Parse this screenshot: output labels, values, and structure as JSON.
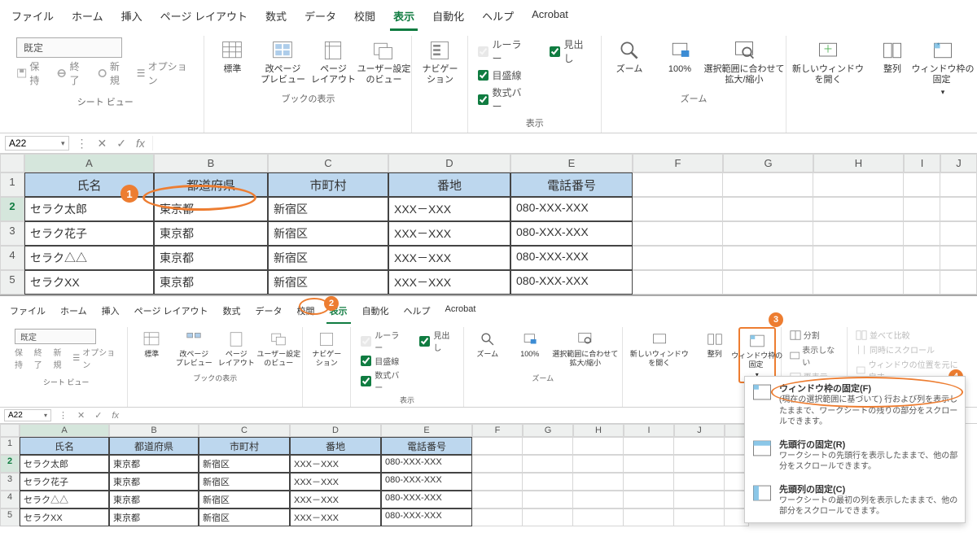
{
  "menus": [
    "ファイル",
    "ホーム",
    "挿入",
    "ページ レイアウト",
    "数式",
    "データ",
    "校閲",
    "表示",
    "自動化",
    "ヘルプ",
    "Acrobat"
  ],
  "name_box": "A22",
  "sheet_gallery": {
    "input": "既定",
    "keep": "保持",
    "end": "終了",
    "new": "新規",
    "opt": "オプション"
  },
  "ribbon_top": {
    "book_views": {
      "normal": "標準",
      "page_break": "改ページ\nプレビュー",
      "page_layout": "ページ\nレイアウト",
      "custom": "ユーザー設定\nのビュー",
      "group": "ブックの表示"
    },
    "nav": {
      "label": "ナビゲー\nション"
    },
    "show": {
      "ruler": "ルーラー",
      "headings": "見出し",
      "gridlines": "目盛線",
      "formula_bar": "数式バー",
      "group": "表示"
    },
    "zoom": {
      "zoom": "ズーム",
      "hundred": "100%",
      "sel": "選択範囲に合わせて\n拡大/縮小",
      "group": "ズーム"
    },
    "window": {
      "new": "新しいウィンドウ\nを開く",
      "arrange": "整列",
      "freeze": "ウィンドウ枠の\n固定 "
    },
    "sheet_views_group": "シート ビュー"
  },
  "ribbon_bot": {
    "side1": {
      "split": "分割",
      "hide": "表示しない",
      "show": "再表示"
    },
    "side2": {
      "a": "並べて比較",
      "b": "同時にスクロール",
      "c": "ウィンドウの位置を元に戻す"
    }
  },
  "freeze_menu": {
    "a": {
      "t": "ウィンドウ枠の固定(F)",
      "d": "(現在の選択範囲に基づいて) 行および列を表示したままで、ワークシートの残りの部分をスクロールできます。"
    },
    "b": {
      "t": "先頭行の固定(R)",
      "d": "ワークシートの先頭行を表示したままで、他の部分をスクロールできます。"
    },
    "c": {
      "t": "先頭列の固定(C)",
      "d": "ワークシートの最初の列を表示したままで、他の部分をスクロールできます。"
    }
  },
  "columns": [
    "A",
    "B",
    "C",
    "D",
    "E",
    "F",
    "G",
    "H",
    "I",
    "J"
  ],
  "table": {
    "headers": [
      "氏名",
      "都道府県",
      "市町村",
      "番地",
      "電話番号"
    ],
    "rows": [
      [
        "セラク太郎",
        "東京都",
        "新宿区",
        "XXX－XXX",
        "080-XXX-XXX"
      ],
      [
        "セラク花子",
        "東京都",
        "新宿区",
        "XXX－XXX",
        "080-XXX-XXX"
      ],
      [
        "セラク△△",
        "東京都",
        "新宿区",
        "XXX－XXX",
        "080-XXX-XXX"
      ],
      [
        "セラクXX",
        "東京都",
        "新宿区",
        "XXX－XXX",
        "080-XXX-XXX"
      ]
    ]
  }
}
